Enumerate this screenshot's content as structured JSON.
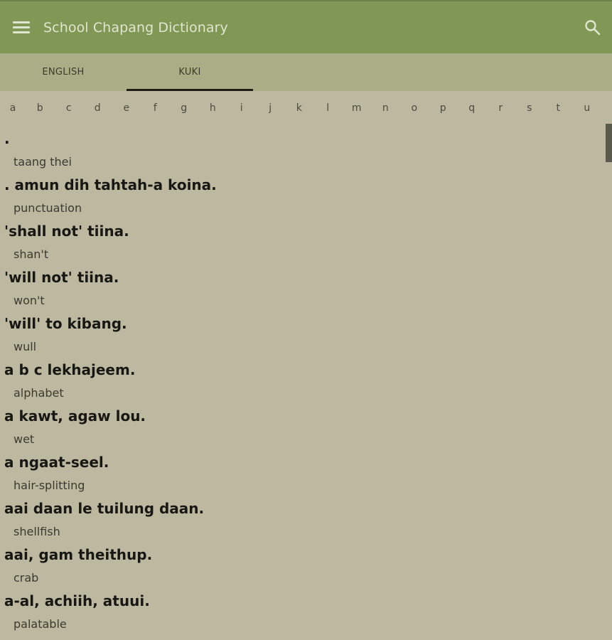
{
  "app": {
    "title": "School Chapang Dictionary"
  },
  "tabs": [
    {
      "label": "ENGLISH",
      "active": false
    },
    {
      "label": "KUKI",
      "active": true
    }
  ],
  "alphabet": [
    "a",
    "b",
    "c",
    "d",
    "e",
    "f",
    "g",
    "h",
    "i",
    "j",
    "k",
    "l",
    "m",
    "n",
    "o",
    "p",
    "q",
    "r",
    "s",
    "t",
    "u"
  ],
  "entries": [
    {
      "headword": ".",
      "translation": "taang thei"
    },
    {
      "headword": ". amun dih tahtah-a koina.",
      "translation": "punctuation"
    },
    {
      "headword": "'shall not' tiina.",
      "translation": "shan't"
    },
    {
      "headword": "'will not' tiina.",
      "translation": "won't"
    },
    {
      "headword": "'will' to kibang.",
      "translation": "wull"
    },
    {
      "headword": "a b c lekhajeem.",
      "translation": "alphabet"
    },
    {
      "headword": "a kawt, agaw lou.",
      "translation": "wet"
    },
    {
      "headword": "a ngaat-seel.",
      "translation": "hair-splitting"
    },
    {
      "headword": "aai daan le tuilung daan.",
      "translation": "shellfish"
    },
    {
      "headword": "aai, gam theithup.",
      "translation": "crab"
    },
    {
      "headword": "a-al, achiih, atuui.",
      "translation": "palatable"
    }
  ],
  "icons": {
    "menu": "menu-icon",
    "search": "search-icon"
  },
  "colors": {
    "appbar": "#809755",
    "tabbar": "#aaad85",
    "background": "#bdb9a0",
    "tab_indicator": "#1f1f1a"
  }
}
